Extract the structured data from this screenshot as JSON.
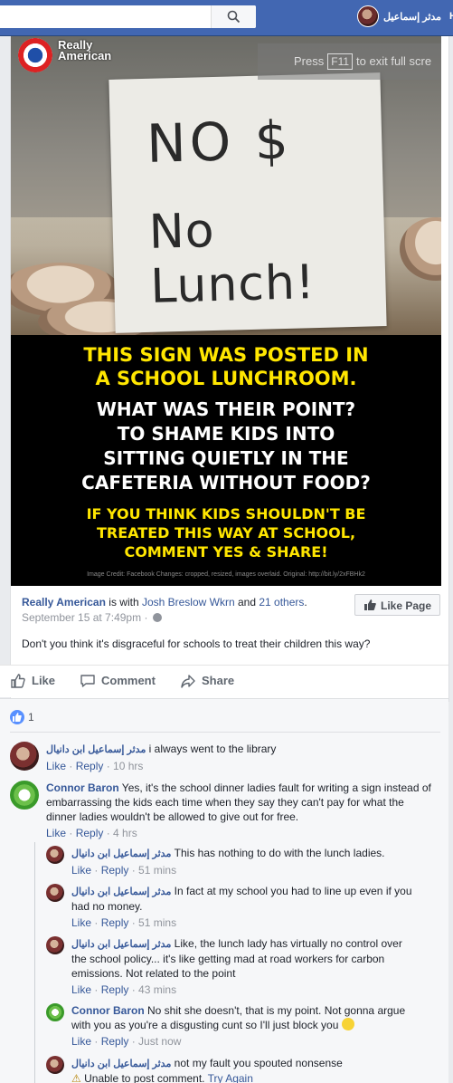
{
  "topbar": {
    "profile_name": "مدثر إسماعيل",
    "home_label": "H"
  },
  "photo": {
    "logo_text_1": "Really",
    "logo_text_2": "American",
    "fullscreen_note_pre": "Press",
    "fullscreen_note_key": "F11",
    "fullscreen_note_post": "to exit full scre",
    "sign_line_1": "NO $",
    "sign_line_2": "No Lunch!",
    "caption": [
      {
        "text": "THIS SIGN WAS POSTED IN",
        "color": "#ffe600"
      },
      {
        "text": "A SCHOOL LUNCHROOM.",
        "color": "#ffe600"
      },
      {
        "text": "WHAT WAS THEIR POINT?",
        "color": "#ffffff"
      },
      {
        "text": "TO SHAME KIDS INTO",
        "color": "#ffffff"
      },
      {
        "text": "SITTING QUIETLY IN THE",
        "color": "#ffffff"
      },
      {
        "text": "CAFETERIA WITHOUT FOOD?",
        "color": "#ffffff"
      },
      {
        "text": "IF YOU THINK KIDS SHOULDN'T BE",
        "color": "#ffe600"
      },
      {
        "text": "TREATED THIS WAY AT SCHOOL,",
        "color": "#ffe600"
      },
      {
        "text": "COMMENT YES & SHARE!",
        "color": "#ffe600"
      }
    ],
    "credit": "Image Credit: Facebook Changes: cropped, resized, images overlaid. Original: http://bit.ly/2xFBHk2"
  },
  "post": {
    "page_name": "Really American",
    "with_text": " is with ",
    "tagged": "Josh Breslow Wkrn",
    "and_text": " and ",
    "others": "21 others",
    "period": ".",
    "date": "September 15 at 7:49pm",
    "separator": "·",
    "like_page_label": "Like Page",
    "text": "Don't you think it's disgraceful for schools to treat their children this way?"
  },
  "actions": {
    "like": "Like",
    "comment": "Comment",
    "share": "Share"
  },
  "reactions": {
    "count": "1"
  },
  "comments": [
    {
      "author": "مدثر إسماعيل ابن دانيال",
      "text": " i always went to the library",
      "time": "10 hrs"
    },
    {
      "author": "Connor Baron",
      "text": " Yes, it's the school dinner ladies fault for writing a sign instead of embarrassing the kids each time when they say they can't pay for what the dinner ladies wouldn't be allowed to give out for free.",
      "time": "4 hrs"
    }
  ],
  "replies": [
    {
      "author": "مدثر إسماعيل ابن دانيال",
      "text": " This has nothing to do with the lunch ladies.",
      "time": "51 mins"
    },
    {
      "author": "مدثر إسماعيل ابن دانيال",
      "text": " In fact at my school you had to line up even if you had no money.",
      "time": "51 mins"
    },
    {
      "author": "مدثر إسماعيل ابن دانيال",
      "text": " Like, the lunch lady has virtually no control over the school policy... it's like getting mad at road workers for carbon emissions. Not related to the point",
      "time": "43 mins"
    },
    {
      "author": "Connor Baron",
      "text": " No shit she doesn't, that is my point. Not gonna argue with you as you're a disgusting cunt so I'll just block you",
      "time": "Just now"
    },
    {
      "author": "مدثر إسماعيل ابن دانيال",
      "text": " not my fault you spouted nonsense"
    }
  ],
  "labels": {
    "like": "Like",
    "reply": "Reply",
    "dot": " · ",
    "error_text": "Unable to post comment.",
    "try_again": "Try Again"
  }
}
